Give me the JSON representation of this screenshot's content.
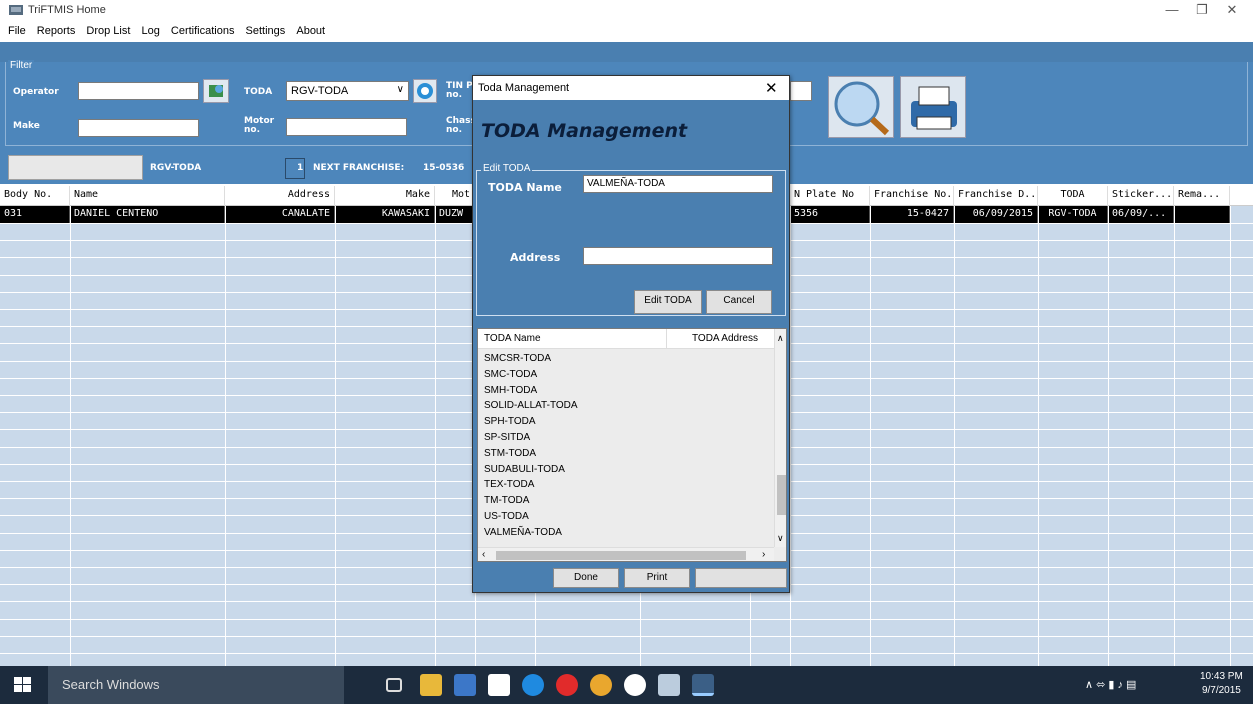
{
  "window": {
    "title": "TriFTMIS Home",
    "controls": [
      "minimize-icon",
      "restore-icon",
      "close-icon"
    ]
  },
  "menu": [
    "File",
    "Reports",
    "Drop List",
    "Log",
    "Certifications",
    "Settings",
    "About"
  ],
  "filter": {
    "group_label": "Filter",
    "operator_label": "Operator",
    "make_label": "Make",
    "toda_label": "TODA",
    "toda_value": "RGV-TODA",
    "motor_label1": "Motor",
    "motor_label2": "no.",
    "tin_label1": "TIN P",
    "tin_label2": "no.",
    "chassis_label1": "Chass",
    "chassis_label2": "no."
  },
  "infobar": {
    "toda": "RGV-TODA",
    "count": "1",
    "next_label": "NEXT FRANCHISE:",
    "next_value": "15-0536"
  },
  "grid": {
    "headers": [
      "Body No.",
      "Name",
      "Address",
      "Make",
      "Mot",
      "N Plate No",
      "Franchise No.",
      "Franchise D...",
      "TODA",
      "Sticker...",
      "Rema..."
    ],
    "rows": [
      [
        "031",
        "DANIEL CENTENO",
        "CANALATE",
        "KAWASAKI",
        "DUZW",
        "5356",
        "15-0427",
        "06/09/2015",
        "RGV-TODA",
        "06/09/...",
        ""
      ]
    ]
  },
  "dialog": {
    "title": "Toda Management",
    "heading": "TODA Management",
    "group_label": "Edit TODA",
    "name_label": "TODA Name",
    "name_value": "VALMEÑA-TODA",
    "address_label": "Address",
    "address_value": "",
    "edit_button": "Edit TODA",
    "cancel_button": "Cancel",
    "list_headers": [
      "TODA Name",
      "TODA Address"
    ],
    "list_items": [
      "SMCSR-TODA",
      "SMC-TODA",
      "SMH-TODA",
      "SOLID-ALLAT-TODA",
      "SPH-TODA",
      "SP-SITDA",
      "STM-TODA",
      "SUDABULI-TODA",
      "TEX-TODA",
      "TM-TODA",
      "US-TODA",
      "VALMEÑA-TODA"
    ],
    "done_button": "Done",
    "print_button": "Print"
  },
  "taskbar": {
    "search_placeholder": "Search Windows",
    "time": "10:43 PM",
    "date": "9/7/2015"
  }
}
